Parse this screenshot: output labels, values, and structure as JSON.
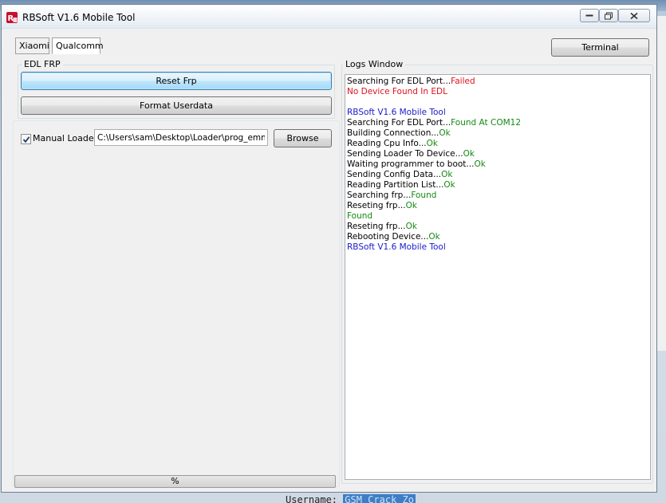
{
  "window": {
    "title": "RBSoft V1.6 Mobile Tool"
  },
  "tabs": [
    {
      "label": "Xiaomi",
      "active": false
    },
    {
      "label": "Qualcomm",
      "active": true
    }
  ],
  "edl_frp": {
    "group_label": "EDL FRP",
    "reset_button": "Reset Frp",
    "format_button": "Format Userdata",
    "manual_loader_label": "Manual Loader",
    "manual_loader_checked": true,
    "loader_path": "C:\\Users\\sam\\Desktop\\Loader\\prog_emmc_f",
    "browse_button": "Browse"
  },
  "terminal_button": "Terminal",
  "progress": {
    "label": "%",
    "value": 0
  },
  "logs": {
    "group_label": "Logs Window",
    "lines": [
      [
        {
          "t": "Searching For EDL Port...",
          "c": "black"
        },
        {
          "t": "Failed",
          "c": "red"
        }
      ],
      [
        {
          "t": "No Device Found In EDL",
          "c": "red"
        }
      ],
      [],
      [
        {
          "t": "RBSoft V1.6 Mobile Tool",
          "c": "blue"
        }
      ],
      [
        {
          "t": "Searching For EDL Port...",
          "c": "black"
        },
        {
          "t": "Found At COM12",
          "c": "green"
        }
      ],
      [
        {
          "t": "Building Connection...",
          "c": "black"
        },
        {
          "t": "Ok",
          "c": "green"
        }
      ],
      [
        {
          "t": "Reading Cpu Info...",
          "c": "black"
        },
        {
          "t": "Ok",
          "c": "green"
        }
      ],
      [
        {
          "t": "Sending Loader To Device...",
          "c": "black"
        },
        {
          "t": "Ok",
          "c": "green"
        }
      ],
      [
        {
          "t": "Waiting programmer to boot...",
          "c": "black"
        },
        {
          "t": "Ok",
          "c": "green"
        }
      ],
      [
        {
          "t": "Sending Config Data...",
          "c": "black"
        },
        {
          "t": "Ok",
          "c": "green"
        }
      ],
      [
        {
          "t": "Reading Partition List...",
          "c": "black"
        },
        {
          "t": "Ok",
          "c": "green"
        }
      ],
      [
        {
          "t": "Searching frp...",
          "c": "black"
        },
        {
          "t": "Found",
          "c": "green"
        }
      ],
      [
        {
          "t": "Reseting frp...",
          "c": "black"
        },
        {
          "t": "Ok",
          "c": "green"
        }
      ],
      [
        {
          "t": "Found",
          "c": "green"
        }
      ],
      [
        {
          "t": "Reseting frp...",
          "c": "black"
        },
        {
          "t": "Ok",
          "c": "green"
        }
      ],
      [
        {
          "t": "Rebooting Device...",
          "c": "black"
        },
        {
          "t": "Ok",
          "c": "green"
        }
      ],
      [
        {
          "t": "RBSoft V1.6 Mobile Tool",
          "c": "blue"
        }
      ]
    ]
  },
  "background": {
    "username_label": "Username:",
    "username_value": "GSM Crack Zo"
  },
  "colors": {
    "log_red": "#e0101c",
    "log_green": "#138a13",
    "log_blue": "#1a1acc",
    "focus_blue": "#3c7fb1"
  },
  "icons": {
    "app": "rbsoft-logo-icon",
    "minimize": "minimize-icon",
    "maximize": "maximize-icon",
    "close": "close-icon",
    "checkbox": "checkmark-icon"
  }
}
